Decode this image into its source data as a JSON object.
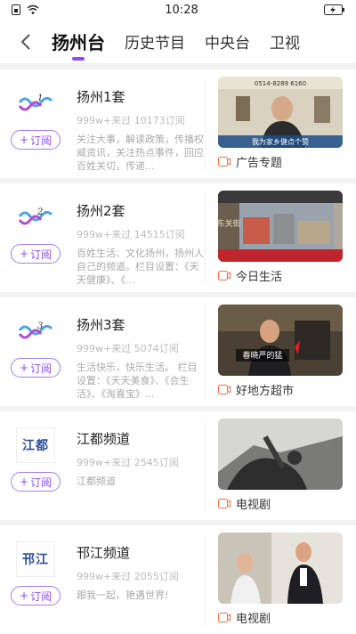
{
  "status": {
    "time": "10:28"
  },
  "nav": {
    "tabs": [
      {
        "label": "扬州台"
      },
      {
        "label": "历史节目"
      },
      {
        "label": "中央台"
      },
      {
        "label": "卫视"
      }
    ]
  },
  "channels": [
    {
      "name": "扬州1套",
      "stats": "999w+来过  10173订阅",
      "desc": "关注大事，解读政策，传播权威资讯，关注热点事件，回应百姓关切，传递...",
      "subscribe": "订阅",
      "program": "广告专题",
      "logo_number": "1"
    },
    {
      "name": "扬州2套",
      "stats": "999w+来过  14515订阅",
      "desc": "百姓生活、文化扬州，扬州人自己的频道。栏目设置：《天天健康》、《...",
      "subscribe": "订阅",
      "program": "今日生活",
      "logo_number": "2"
    },
    {
      "name": "扬州3套",
      "stats": "999w+来过  5074订阅",
      "desc": "生活快乐，快乐生活。 栏目设置：《天天美食》、《会生活》、《淘喜宝》...",
      "subscribe": "订阅",
      "program": "好地方超市",
      "logo_number": "3"
    },
    {
      "name": "江都频道",
      "stats": "999w+来过  2545订阅",
      "desc": "江都频道",
      "subscribe": "订阅",
      "program": "电视剧",
      "logo_text": "江都"
    },
    {
      "name": "邗江频道",
      "stats": "999w+来过  2055订阅",
      "desc": "跟我一起，艳遇世界!",
      "subscribe": "订阅",
      "program": "电视剧",
      "logo_text": "邗江"
    }
  ],
  "thumb_captions": {
    "c1": "0514-8289 6160",
    "c1_bottom": "我为家乡健点个赞",
    "c3_overlay": "春晓严的猛",
    "c2_sign": "东关街"
  },
  "colors": {
    "accent": "#8a4bff",
    "program_icon": "#ff6a3d"
  }
}
